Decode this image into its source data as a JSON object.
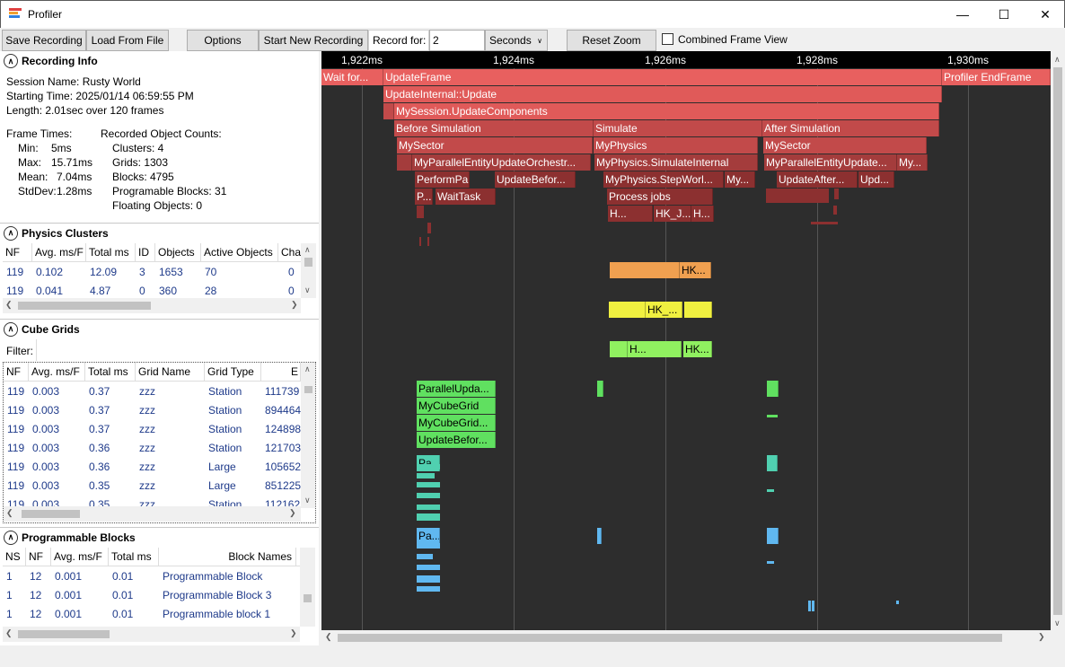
{
  "window": {
    "title": "Profiler",
    "minimize": "—",
    "maximize": "☐",
    "close": "✕"
  },
  "toolbar": {
    "save_recording": "Save Recording",
    "load_from_file": "Load From File",
    "options": "Options",
    "start_new_recording": "Start New Recording",
    "record_for_label": "Record for:",
    "record_for_value": "2",
    "unit": "Seconds",
    "reset_zoom": "Reset Zoom",
    "combined_frame_view": "Combined Frame View",
    "combined_frame_view_checked": false
  },
  "recording_info": {
    "header": "Recording Info",
    "session_name": "Session Name: Rusty World",
    "starting_time": "Starting Time: 2025/01/14 06:59:55 PM",
    "length": "Length: 2.01sec over 120 frames",
    "frame_times_label": "Frame Times:",
    "frame_times": [
      {
        "label": "Min:",
        "value": "5ms"
      },
      {
        "label": "Max:",
        "value": "15.71ms"
      },
      {
        "label": "Mean:",
        "value": "7.04ms"
      },
      {
        "label": "StdDev:",
        "value": "1.28ms"
      }
    ],
    "counts_label": "Recorded Object Counts:",
    "counts": [
      "Clusters: 4",
      "Grids: 1303",
      "Blocks: 4795",
      "Programable Blocks: 31",
      "Floating Objects: 0"
    ]
  },
  "physics_clusters": {
    "header": "Physics Clusters",
    "columns": [
      "NF",
      "Avg. ms/F",
      "Total ms",
      "ID",
      "Objects",
      "Active Objects",
      "Cha"
    ],
    "rows": [
      [
        "119",
        "0.102",
        "12.09",
        "3",
        "1653",
        "70",
        "0"
      ],
      [
        "119",
        "0.041",
        "4.87",
        "0",
        "360",
        "28",
        "0"
      ]
    ]
  },
  "cube_grids": {
    "header": "Cube Grids",
    "filter_label": "Filter:",
    "filter_value": "",
    "columns": [
      "NF",
      "Avg. ms/F",
      "Total ms",
      "Grid Name",
      "Grid Type",
      "E"
    ],
    "rows": [
      [
        "119",
        "0.003",
        "0.37",
        "zzz",
        "Station",
        "111739"
      ],
      [
        "119",
        "0.003",
        "0.37",
        "zzz",
        "Station",
        "894464"
      ],
      [
        "119",
        "0.003",
        "0.37",
        "zzz",
        "Station",
        "124898"
      ],
      [
        "119",
        "0.003",
        "0.36",
        "zzz",
        "Station",
        "121703"
      ],
      [
        "119",
        "0.003",
        "0.36",
        "zzz",
        "Large",
        "105652"
      ],
      [
        "119",
        "0.003",
        "0.35",
        "zzz",
        "Large",
        "851225"
      ],
      [
        "119",
        "0.003",
        "0.35",
        "zzz",
        "Station",
        "112162"
      ]
    ]
  },
  "programmable_blocks": {
    "header": "Programmable Blocks",
    "columns": [
      "NS",
      "NF",
      "Avg. ms/F",
      "Total ms",
      "Block Names"
    ],
    "rows": [
      [
        "1",
        "12",
        "0.001",
        "0.01",
        "Programmable Block"
      ],
      [
        "1",
        "12",
        "0.001",
        "0.01",
        "Programmable Block 3"
      ],
      [
        "1",
        "12",
        "0.001",
        "0.01",
        "Programmable block 1"
      ]
    ]
  },
  "timeline": {
    "ticks": [
      "1,922ms",
      "1,924ms",
      "1,926ms",
      "1,928ms",
      "1,930ms"
    ],
    "colors": {
      "frame": "#e8605f",
      "update": "#e05a59",
      "section": "#c24a4a",
      "deep": "#a43c3c",
      "deeper": "#8c3030",
      "orange": "#f0a050",
      "yellow": "#f0f040",
      "green": "#90f060",
      "brightgreen": "#60e060",
      "teal": "#50d0b0",
      "blue": "#60b8f0"
    },
    "labels": {
      "wait": "Wait for...",
      "update_frame": "UpdateFrame",
      "profiler_end": "Profiler EndFrame",
      "update_internal": "UpdateInternal::Update",
      "session_update": "MySession.UpdateComponents",
      "before_sim": "Before Simulation",
      "simulate": "Simulate",
      "after_sim": "After Simulation",
      "sector1": "MySector",
      "physics": "MyPhysics",
      "sector2": "MySector",
      "par_entity1": "MyParallelEntityUpdateOrchestr...",
      "physics_internal": "MyPhysics.SimulateInternal",
      "par_entity2": "MyParallelEntityUpdate...",
      "my_short": "My...",
      "p_short": "P...",
      "perform_par": "PerformParall...",
      "update_before": "UpdateBefor...",
      "stepworld": "MyPhysics.StepWorl...",
      "my2": "My...",
      "update_after": "UpdateAfter...",
      "upd": "Upd...",
      "waittask": "WaitTask",
      "process_jobs": "Process jobs",
      "h1": "H...",
      "hkj": "HK_J...",
      "h2": "H...",
      "hk_orange": "HK...",
      "hk_yellow": "HK_...",
      "h_green": "H...",
      "hk_green": "HK...",
      "par_update": "ParallelUpda...",
      "cube_grid1": "MyCubeGrid",
      "cube_grid2": "MyCubeGrid...",
      "update_before2": "UpdateBefor...",
      "pa_teal": "Pa...",
      "pa_blue": "Pa..."
    }
  }
}
